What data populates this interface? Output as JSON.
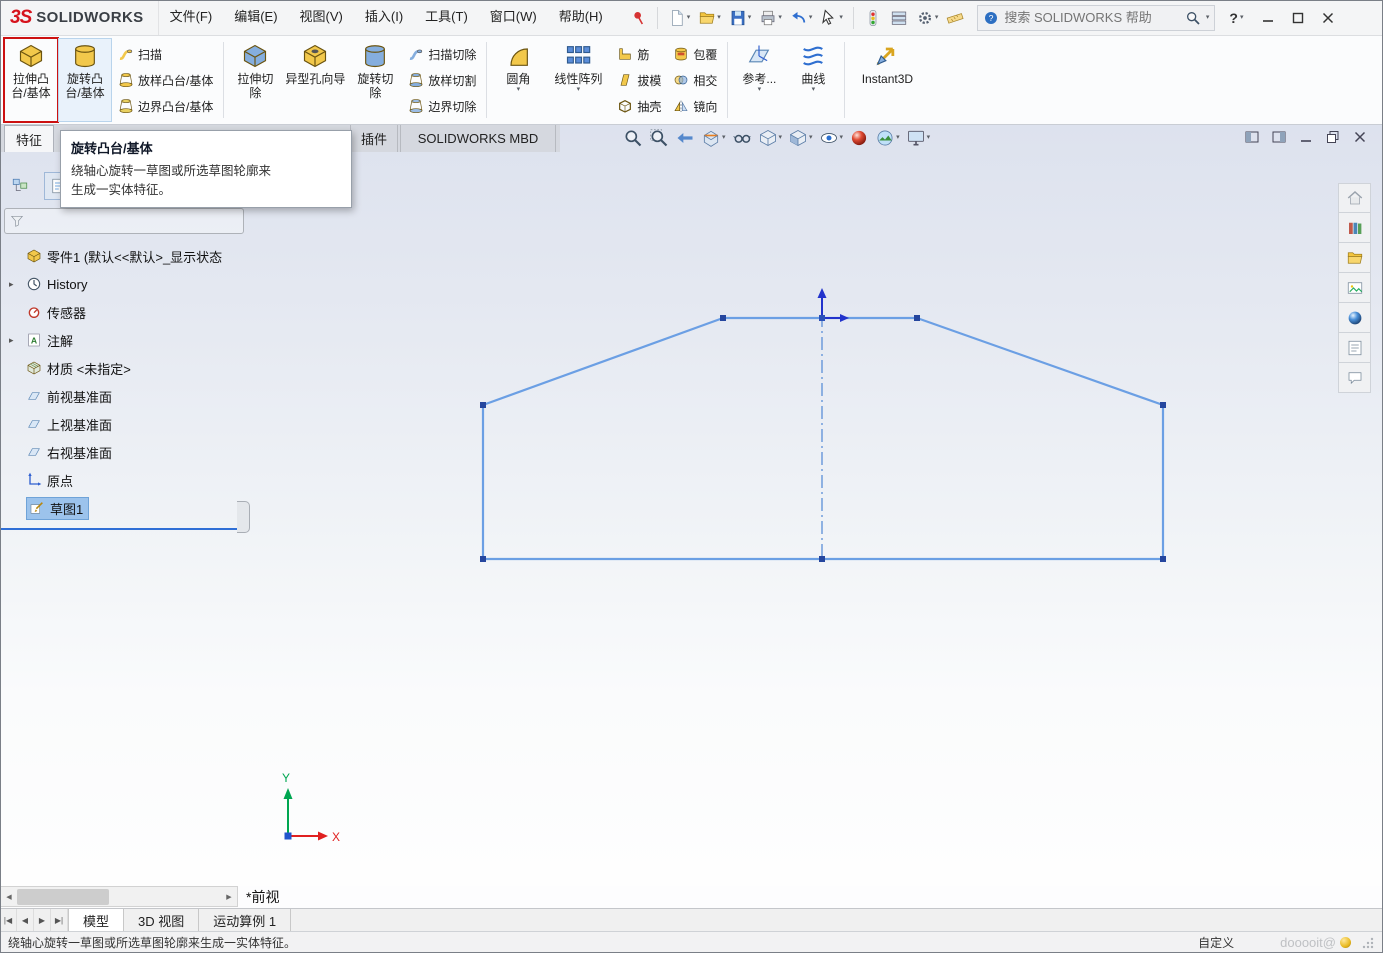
{
  "colors": {
    "brand_red": "#d6131c",
    "sketch_line": "#6b9fe4",
    "selection": "#9cc3ec",
    "highlight_red": "#cc1111"
  },
  "titlebar": {
    "brand": "SOLIDWORKS",
    "menus": [
      "文件(F)",
      "编辑(E)",
      "视图(V)",
      "插入(I)",
      "工具(T)",
      "窗口(W)",
      "帮助(H)"
    ],
    "search_text": "搜索 SOLIDWORKS 帮助",
    "help_label": "?"
  },
  "ribbon": {
    "extrude_boss": [
      "拉伸凸",
      "台/基体"
    ],
    "revolve_boss": [
      "旋转凸",
      "台/基体"
    ],
    "sweep": "扫描",
    "loft": "放样凸台/基体",
    "boundary": "边界凸台/基体",
    "extrude_cut": [
      "拉伸切",
      "除"
    ],
    "hole_wizard": "异型孔向导",
    "revolve_cut": [
      "旋转切",
      "除"
    ],
    "swept_cut": "扫描切除",
    "lofted_cut": "放样切割",
    "boundary_cut": "边界切除",
    "fillet": "圆角",
    "linear_pattern": "线性阵列",
    "rib": "筋",
    "draft": "拔模",
    "shell": "抽壳",
    "wrap": "包覆",
    "intersect": "相交",
    "mirror": "镜向",
    "reference": "参考...",
    "curves": "曲线",
    "instant3d": "Instant3D"
  },
  "tabs": {
    "features": "特征",
    "addins": "插件",
    "mbd": "SOLIDWORKS MBD"
  },
  "tooltip": {
    "title": "旋转凸台/基体",
    "line1": "绕轴心旋转一草图或所选草图轮廓来",
    "line2": "生成一实体特征。"
  },
  "tree": {
    "root": "零件1 (默认<<默认>_显示状态",
    "items": [
      {
        "label": "History"
      },
      {
        "label": "传感器"
      },
      {
        "label": "注解"
      },
      {
        "label": "材质 <未指定>"
      },
      {
        "label": "前视基准面"
      },
      {
        "label": "上视基准面"
      },
      {
        "label": "右视基准面"
      },
      {
        "label": "原点"
      },
      {
        "label": "草图1"
      }
    ]
  },
  "viewport": {
    "view_label": "*前视",
    "axis_x": "X",
    "axis_y": "Y"
  },
  "doc_tabs": [
    "模型",
    "3D 视图",
    "运动算例 1"
  ],
  "statusbar": {
    "message": "绕轴心旋转一草图或所选草图轮廓来生成一实体特征。",
    "customize": "自定义",
    "watermark": "dooooit@"
  },
  "icons": {
    "titlebar": [
      "new-document-icon",
      "open-icon",
      "save-icon",
      "print-icon",
      "undo-icon",
      "select-cursor-icon",
      "traffic-light-icon",
      "display-rows-icon",
      "gear-icon",
      "measure-icon",
      "help-question-icon",
      "search-icon"
    ],
    "headsup": [
      "zoom-fit-icon",
      "zoom-area-icon",
      "previous-view-icon",
      "section-view-icon",
      "annotation-view-icon",
      "view-orientation-icon",
      "display-style-icon",
      "hide-show-icon",
      "edit-appearance-icon",
      "apply-scene-icon",
      "view-settings-icon"
    ],
    "taskpane": [
      "home-icon",
      "design-library-icon",
      "file-explorer-icon",
      "view-palette-icon",
      "appearances-icon",
      "custom-properties-icon",
      "forum-icon"
    ]
  }
}
